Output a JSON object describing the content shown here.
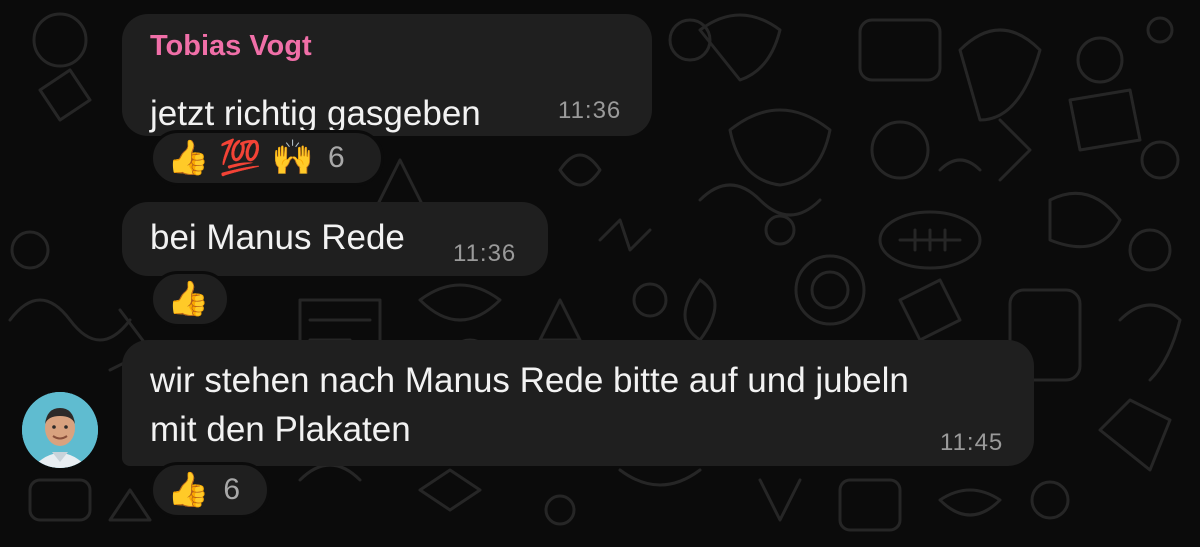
{
  "messages": [
    {
      "sender": "Tobias Vogt",
      "lines": [
        "jetzt richtig gasgeben"
      ],
      "time": "11:36",
      "reactions": {
        "emojis": [
          "👍",
          "💯",
          "🙌"
        ],
        "count": "6"
      }
    },
    {
      "lines": [
        "bei Manus Rede"
      ],
      "time": "11:36",
      "reactions": {
        "emojis": [
          "👍"
        ],
        "count": ""
      }
    },
    {
      "lines": [
        "wir stehen nach Manus Rede bitte auf und jubeln",
        "mit den Plakaten"
      ],
      "time": "11:45",
      "reactions": {
        "emojis": [
          "👍"
        ],
        "count": "6"
      }
    }
  ],
  "colors": {
    "background": "#0b0b0b",
    "bubble": "#1f1f1f",
    "sender_name": "#f06fa8",
    "timestamp": "#9a9a9a",
    "avatar_bg": "#5fbcd0"
  },
  "icons": {
    "background_pattern": "chat-doodle-wallpaper",
    "avatar": "user-avatar-photo"
  }
}
